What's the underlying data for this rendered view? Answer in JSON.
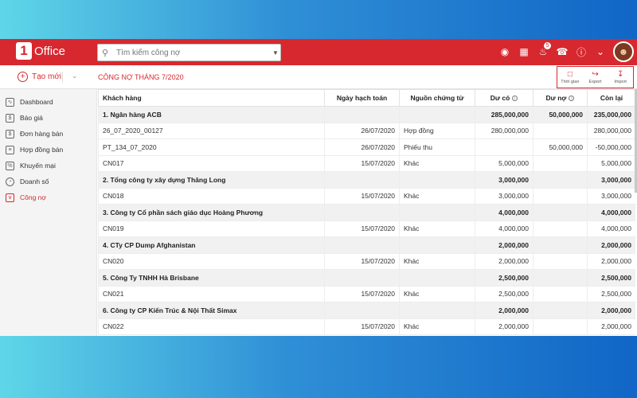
{
  "topbar": {
    "logo_text": "Office",
    "logo_mark": "1",
    "search_placeholder": "Tìm kiếm công nợ",
    "notification_count": "5",
    "icons": [
      "globe-icon",
      "keyboard-icon",
      "bell-icon",
      "headset-icon",
      "help-icon",
      "chevron-down-icon",
      "avatar"
    ]
  },
  "subbar": {
    "new_label": "Tạo mới",
    "title": "CÔNG NỢ THÁNG 7/2020",
    "actions": [
      {
        "label": "Thời gian",
        "icon": "calendar-icon"
      },
      {
        "label": "Export",
        "icon": "export-icon"
      },
      {
        "label": "Import",
        "icon": "import-icon"
      }
    ]
  },
  "sidebar": {
    "items": [
      {
        "label": "Dashboard",
        "icon": "chart-icon",
        "active": false
      },
      {
        "label": "Báo giá",
        "icon": "dollar-doc-icon",
        "active": false
      },
      {
        "label": "Đơn hàng bán",
        "icon": "order-icon",
        "active": false
      },
      {
        "label": "Hợp đồng bán",
        "icon": "contract-icon",
        "active": false
      },
      {
        "label": "Khuyến mại",
        "icon": "percent-icon",
        "active": false
      },
      {
        "label": "Doanh số",
        "icon": "pie-icon",
        "active": false
      },
      {
        "label": "Công nợ",
        "icon": "debt-icon",
        "active": true
      }
    ]
  },
  "table": {
    "headers": [
      "Khách hàng",
      "Ngày hạch toán",
      "Nguồn chứng từ",
      "Dư có",
      "Dư nợ",
      "Còn lại"
    ],
    "rows": [
      {
        "type": "group",
        "cells": [
          "1. Ngân hàng ACB",
          "",
          "",
          "285,000,000",
          "50,000,000",
          "235,000,000"
        ]
      },
      {
        "type": "item",
        "cells": [
          "26_07_2020_00127",
          "26/07/2020",
          "Hợp đồng",
          "280,000,000",
          "",
          "280,000,000"
        ]
      },
      {
        "type": "item",
        "cells": [
          "PT_134_07_2020",
          "26/07/2020",
          "Phiếu thu",
          "",
          "50,000,000",
          "-50,000,000"
        ]
      },
      {
        "type": "item",
        "cells": [
          "CN017",
          "15/07/2020",
          "Khác",
          "5,000,000",
          "",
          "5,000,000"
        ]
      },
      {
        "type": "group",
        "cells": [
          "2. Tổng công ty xây dựng Thăng Long",
          "",
          "",
          "3,000,000",
          "",
          "3,000,000"
        ]
      },
      {
        "type": "item",
        "cells": [
          "CN018",
          "15/07/2020",
          "Khác",
          "3,000,000",
          "",
          "3,000,000"
        ]
      },
      {
        "type": "group",
        "cells": [
          "3. Công ty Cổ phần sách giáo dục Hoàng Phương",
          "",
          "",
          "4,000,000",
          "",
          "4,000,000"
        ]
      },
      {
        "type": "item",
        "cells": [
          "CN019",
          "15/07/2020",
          "Khác",
          "4,000,000",
          "",
          "4,000,000"
        ]
      },
      {
        "type": "group",
        "cells": [
          "4. CTy CP Dump Afghanistan",
          "",
          "",
          "2,000,000",
          "",
          "2,000,000"
        ]
      },
      {
        "type": "item",
        "cells": [
          "CN020",
          "15/07/2020",
          "Khác",
          "2,000,000",
          "",
          "2,000,000"
        ]
      },
      {
        "type": "group",
        "cells": [
          "5. Công Ty TNHH Hà Brisbane",
          "",
          "",
          "2,500,000",
          "",
          "2,500,000"
        ]
      },
      {
        "type": "item",
        "cells": [
          "CN021",
          "15/07/2020",
          "Khác",
          "2,500,000",
          "",
          "2,500,000"
        ]
      },
      {
        "type": "group",
        "cells": [
          "6. Công ty CP Kiến Trúc & Nội Thất Simax",
          "",
          "",
          "2,000,000",
          "",
          "2,000,000"
        ]
      },
      {
        "type": "item",
        "cells": [
          "CN022",
          "15/07/2020",
          "Khác",
          "2,000,000",
          "",
          "2,000,000"
        ]
      }
    ]
  },
  "colors": {
    "brand": "#d7282f",
    "group_row": "#f1f1f1"
  }
}
